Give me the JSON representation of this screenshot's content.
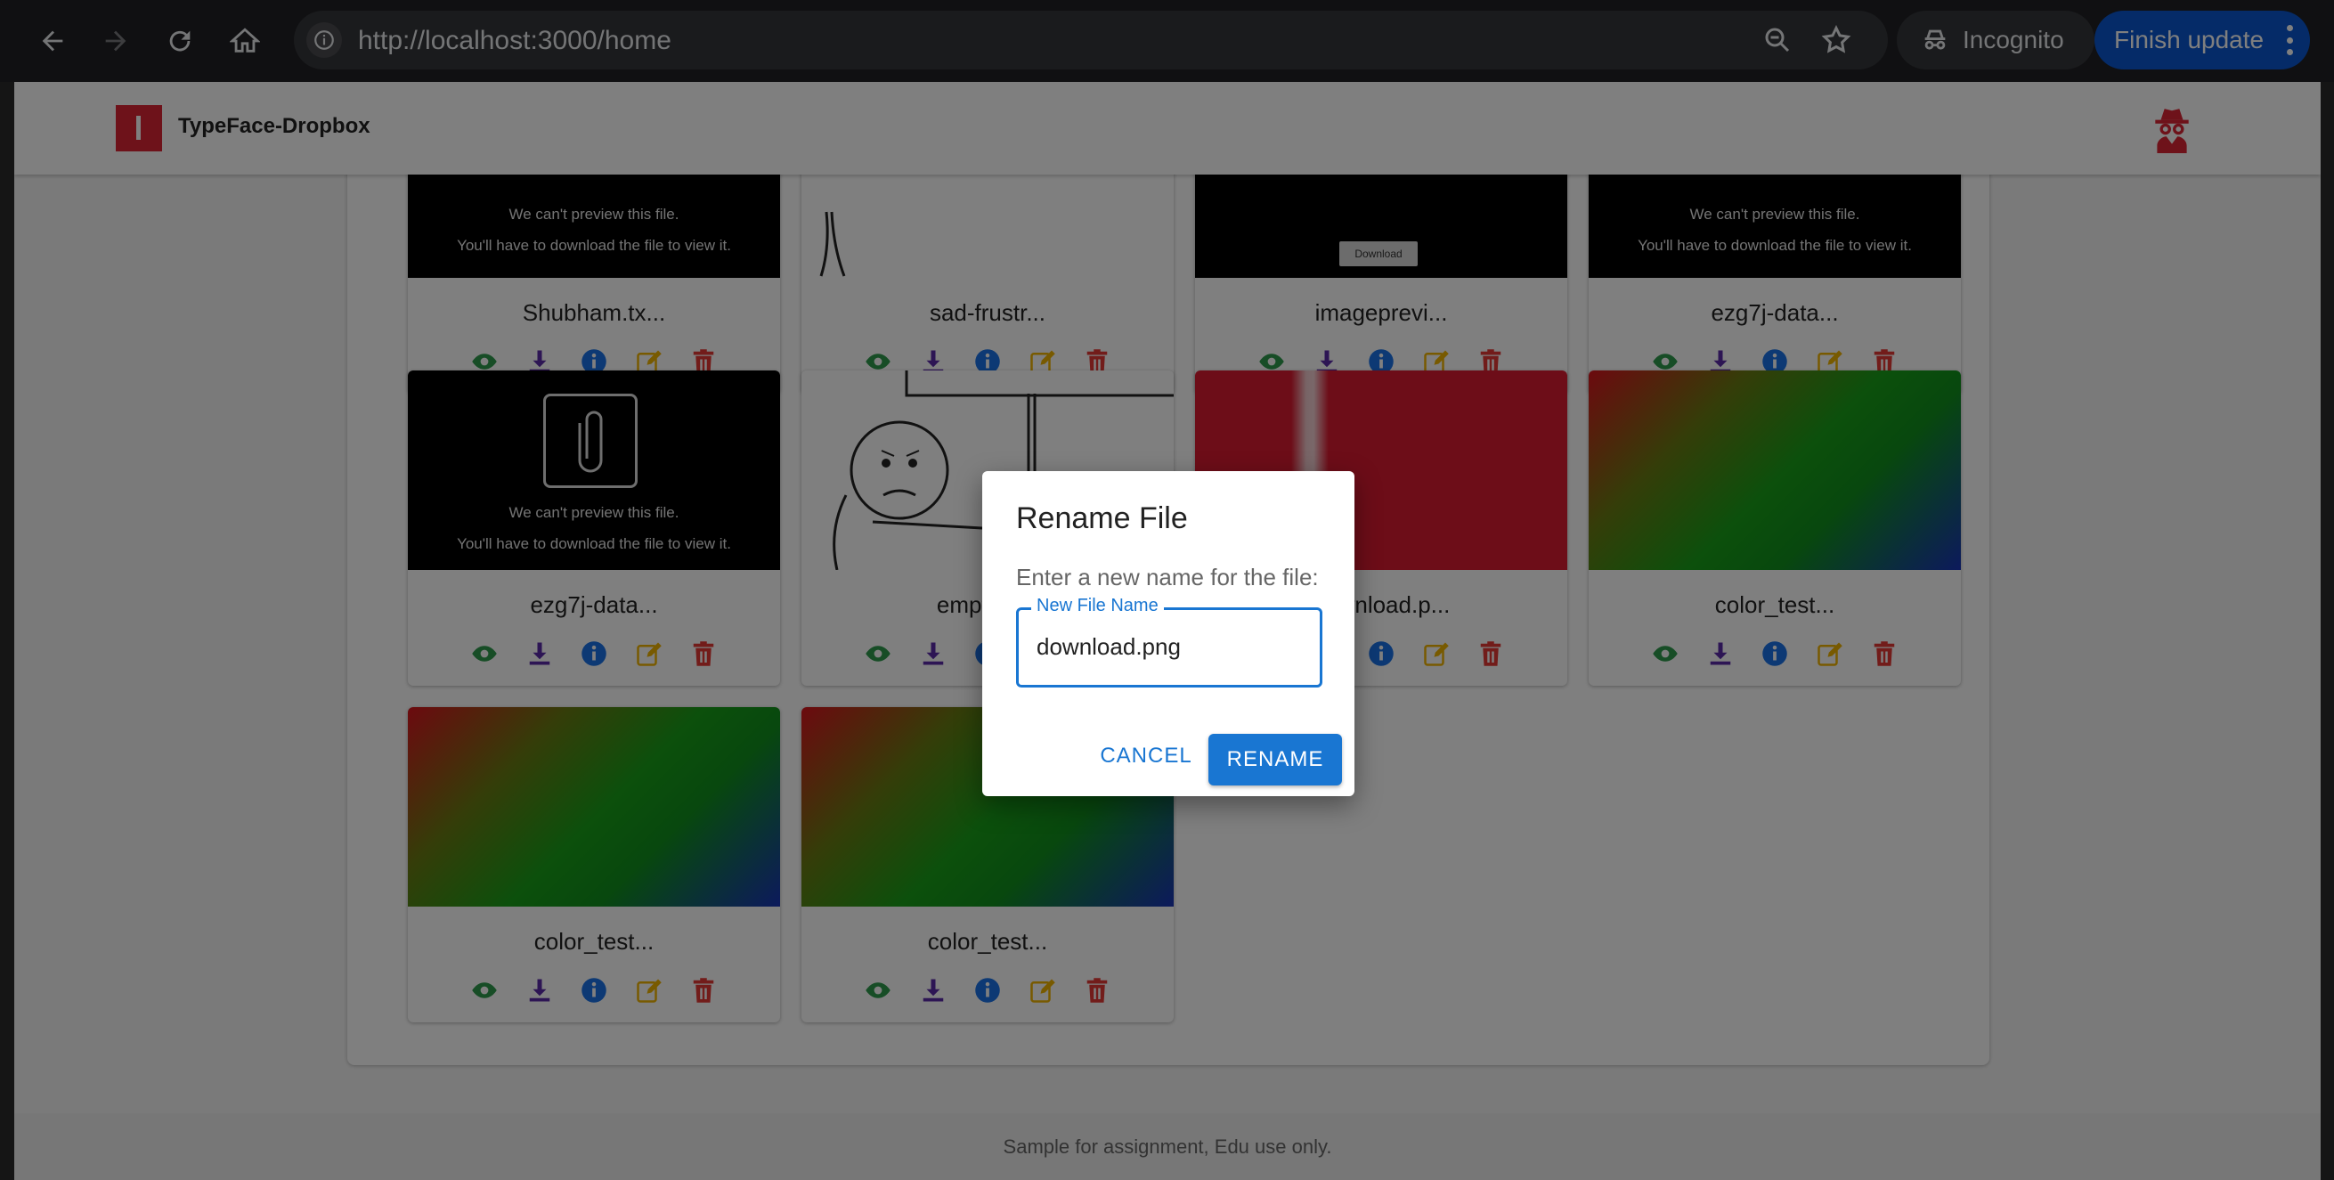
{
  "browser": {
    "url": "http://localhost:3000/home",
    "incognito_label": "Incognito",
    "update_label": "Finish update"
  },
  "app": {
    "brand": "TypeFace-Dropbox",
    "footer": "Sample for assignment, Edu use only."
  },
  "preview_text": {
    "line1": "We can't preview this file.",
    "line2": "You'll have to download the file to view it.",
    "download": "Download"
  },
  "files": [
    {
      "name": "Shubham.tx...",
      "thumb": "black-preview"
    },
    {
      "name": "sad-frustr...",
      "thumb": "sketch"
    },
    {
      "name": "imageprevi...",
      "thumb": "black-download"
    },
    {
      "name": "ezg7j-data...",
      "thumb": "black-preview"
    },
    {
      "name": "ezg7j-data...",
      "thumb": "black-preview"
    },
    {
      "name": "emptyta...",
      "thumb": "sketch"
    },
    {
      "name": "download.p...",
      "thumb": "red"
    },
    {
      "name": "color_test...",
      "thumb": "gradient"
    },
    {
      "name": "color_test...",
      "thumb": "gradient"
    },
    {
      "name": "color_test...",
      "thumb": "gradient"
    }
  ],
  "dialog": {
    "title": "Rename File",
    "text": "Enter a new name for the file:",
    "field_label": "New File Name",
    "field_value": "download.png",
    "cancel": "CANCEL",
    "rename": "RENAME"
  },
  "colors": {
    "view": "#2e9a4c",
    "download": "#5b2aa8",
    "info": "#1a73e8",
    "edit": "#f0b400",
    "delete": "#e53935",
    "primary": "#1976d2"
  }
}
